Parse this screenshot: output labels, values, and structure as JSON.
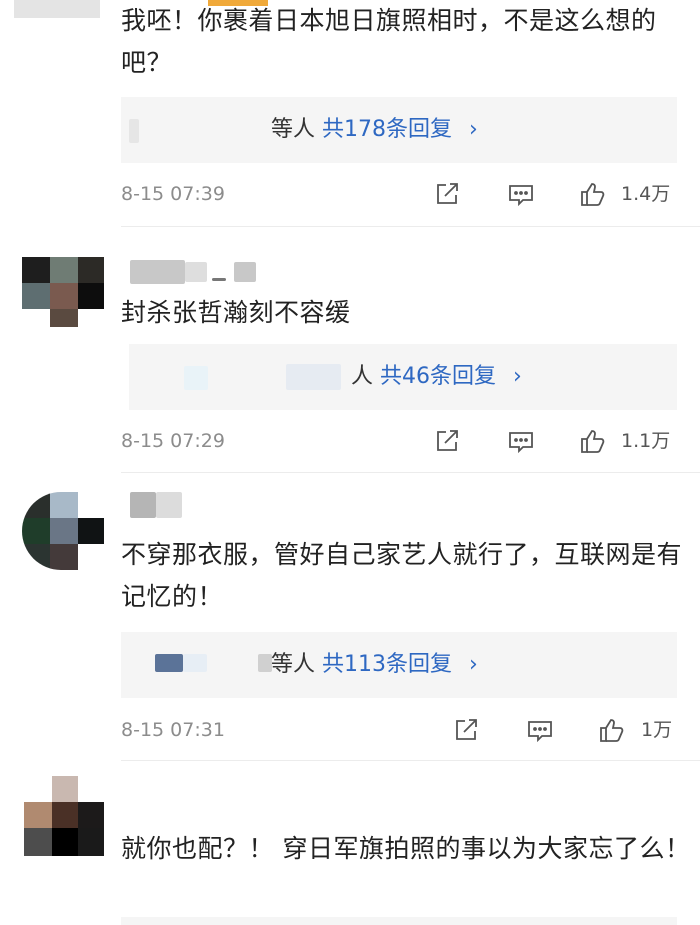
{
  "comments": [
    {
      "text": "我呸！你裹着日本旭日旗照相时，不是这么想的吧？",
      "reply_prefix": "等人",
      "reply_count": "共178条回复",
      "time": "8-15 07:39",
      "likes": "1.4万"
    },
    {
      "text": "封杀张哲瀚刻不容缓",
      "reply_prefix": "人",
      "reply_count": "共46条回复",
      "time": "8-15 07:29",
      "likes": "1.1万"
    },
    {
      "text": "不穿那衣服，管好自己家艺人就行了，互联网是有记忆的！",
      "reply_prefix": "等人",
      "reply_count": "共113条回复",
      "time": "8-15 07:31",
      "likes": "1万"
    },
    {
      "text": "就你也配？！ 穿日军旗拍照的事以为大家忘了么！",
      "reply_prefix": "",
      "reply_count": "",
      "time": "",
      "likes": ""
    }
  ],
  "icons": {
    "share": "share-icon",
    "comment": "comment-icon",
    "like": "thumbs-up-icon",
    "chevron": "chevron-right-icon"
  },
  "colors": {
    "link": "#2e68c2",
    "meta": "#8c8c8c",
    "reply_bg": "#f5f5f5"
  }
}
